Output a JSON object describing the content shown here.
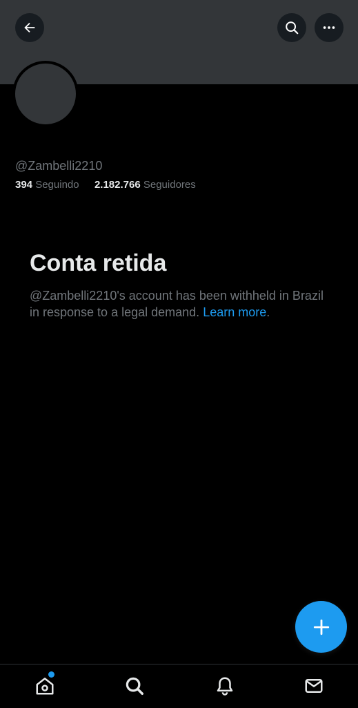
{
  "profile": {
    "handle": "@Zambelli2210",
    "following_count": "394",
    "following_label": "Seguindo",
    "followers_count": "2.182.766",
    "followers_label": "Seguidores"
  },
  "withheld": {
    "title": "Conta retida",
    "body": "@Zambelli2210's account has been withheld in Brazil in response to a legal demand.",
    "link_label": "Learn more",
    "trailing": "."
  },
  "icons": {
    "back": "arrow-left-icon",
    "search": "search-icon",
    "more": "more-horizontal-icon",
    "compose": "plus-icon",
    "home": "home-icon",
    "explore": "search-icon",
    "notifications": "bell-icon",
    "messages": "mail-icon"
  },
  "colors": {
    "background": "#000000",
    "banner": "#333639",
    "accent": "#1d9bf0",
    "primary_text": "#e7e9ea",
    "secondary_text": "#71767b"
  }
}
